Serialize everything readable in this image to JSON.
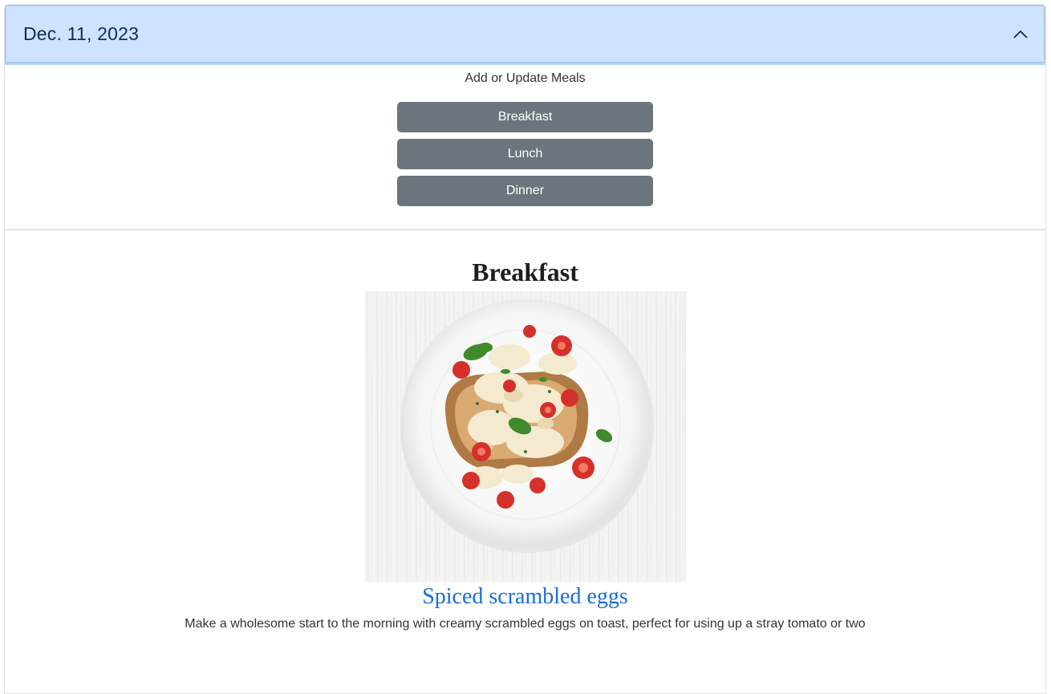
{
  "accordion": {
    "date": "Dec. 11, 2023",
    "toggle_icon": "chevron-up-icon"
  },
  "update": {
    "label": "Add or Update Meals",
    "buttons": [
      "Breakfast",
      "Lunch",
      "Dinner"
    ]
  },
  "meal": {
    "heading": "Breakfast",
    "image": "scrambled-eggs-on-toast-photo",
    "recipe_title": "Spiced scrambled eggs",
    "description": "Make a wholesome start to the morning with creamy scrambled eggs on toast, perfect for using up a stray tomato or two"
  },
  "colors": {
    "header_bg": "#cfe2ff",
    "button_bg": "#6c757d",
    "link": "#1a6dd8"
  }
}
